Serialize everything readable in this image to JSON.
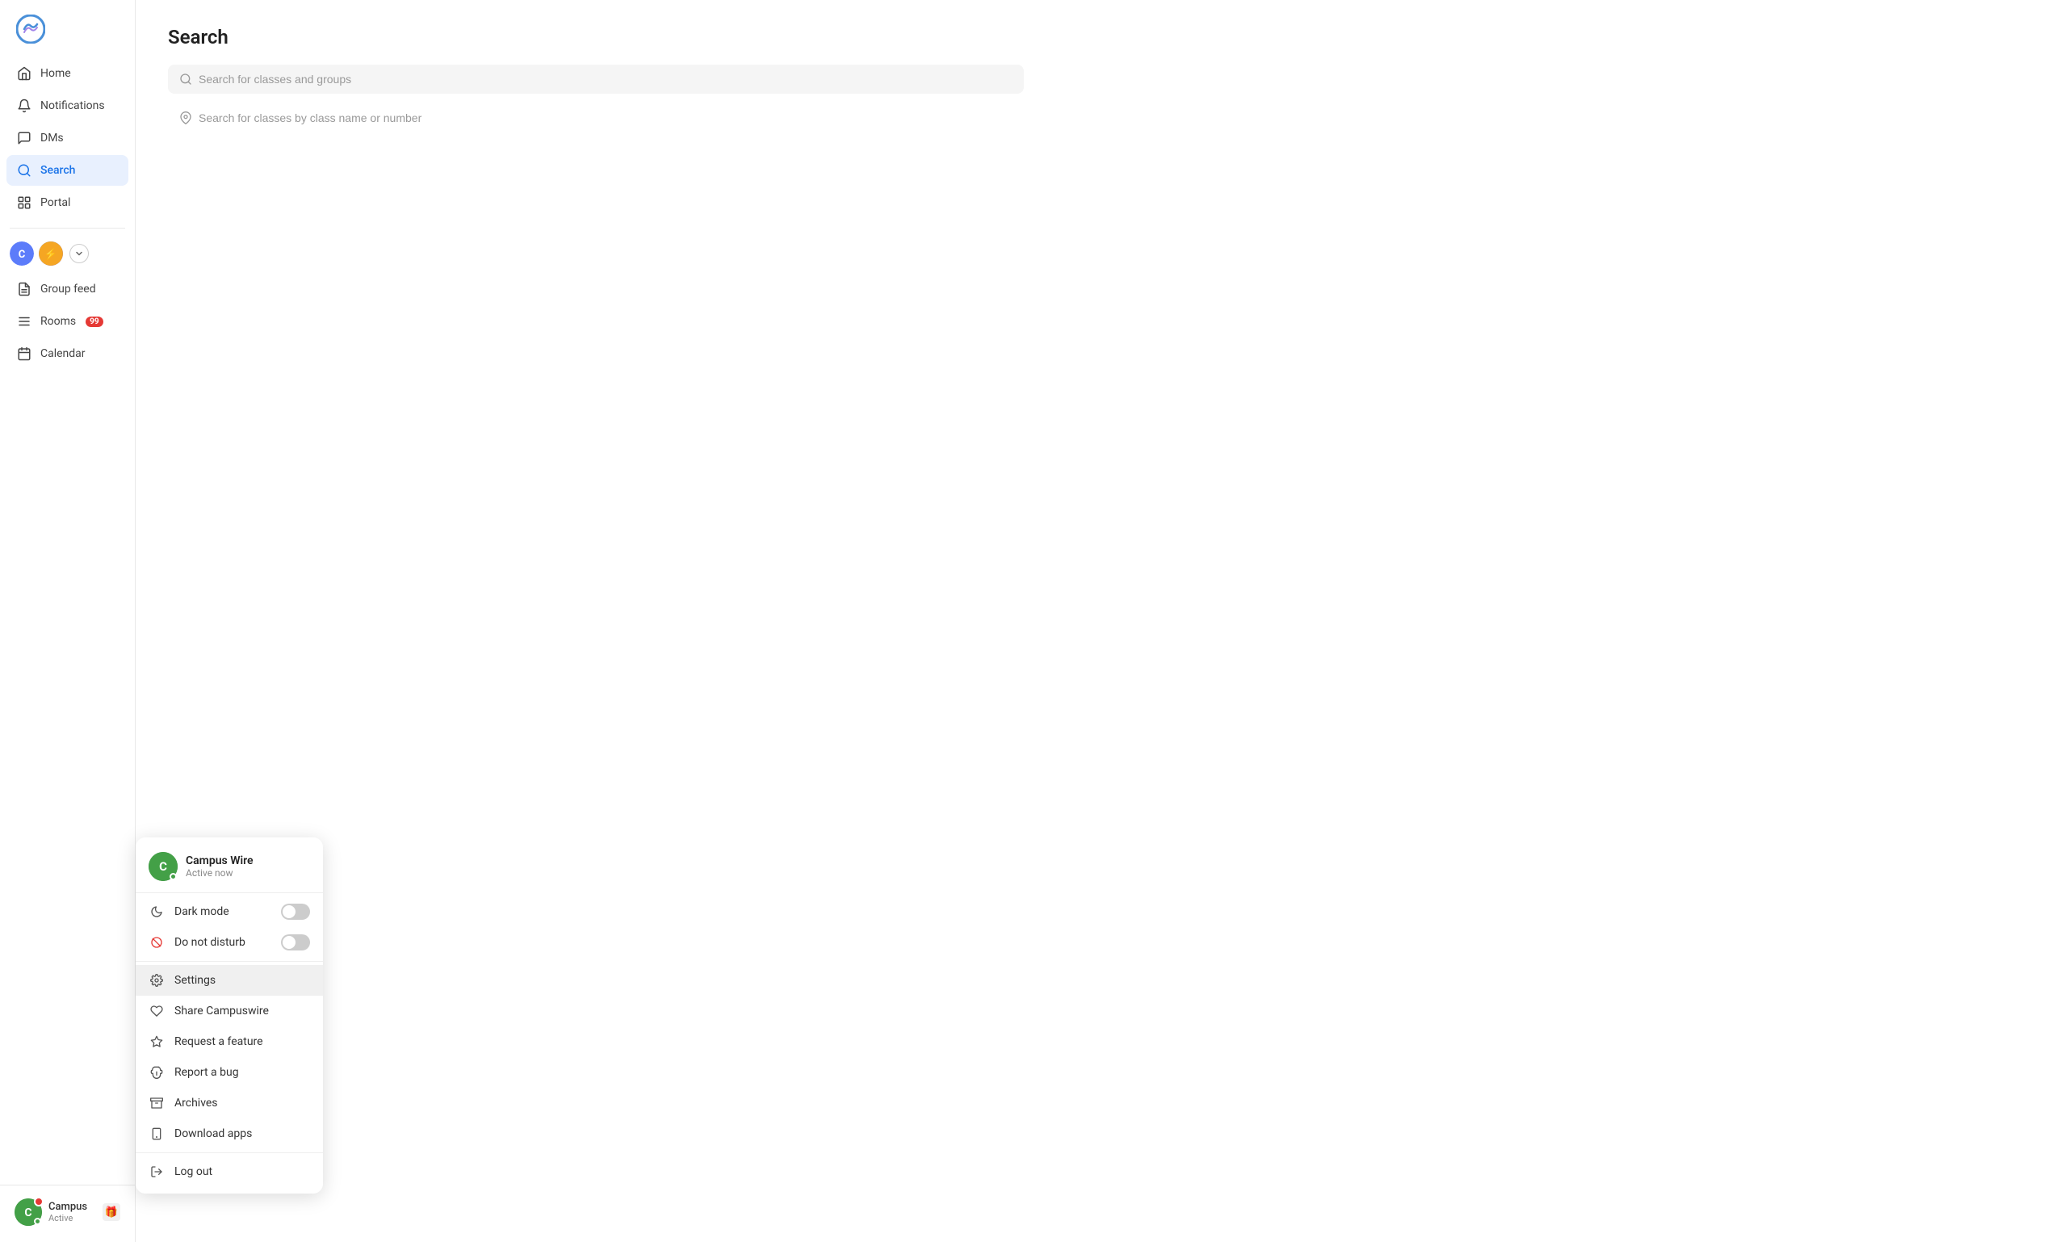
{
  "app": {
    "title": "Campus Wire"
  },
  "sidebar": {
    "nav_items": [
      {
        "id": "home",
        "label": "Home",
        "active": false
      },
      {
        "id": "notifications",
        "label": "Notifications",
        "active": false
      },
      {
        "id": "dms",
        "label": "DMs",
        "active": false
      },
      {
        "id": "search",
        "label": "Search",
        "active": true
      },
      {
        "id": "portal",
        "label": "Portal",
        "active": false
      }
    ],
    "group_section": [
      {
        "id": "group-feed",
        "label": "Group feed",
        "active": false
      },
      {
        "id": "rooms",
        "label": "Rooms",
        "badge": "99",
        "active": false
      },
      {
        "id": "calendar",
        "label": "Calendar",
        "active": false
      }
    ],
    "user": {
      "name": "Campus",
      "status": "Active"
    }
  },
  "search_page": {
    "title": "Search",
    "search_placeholder": "Search for classes and groups",
    "class_search_placeholder": "Search for classes by class name or number"
  },
  "dropdown": {
    "user_name": "Campus Wire",
    "user_status": "Active now",
    "items": [
      {
        "id": "dark-mode",
        "label": "Dark mode",
        "type": "toggle",
        "value": false
      },
      {
        "id": "do-not-disturb",
        "label": "Do not disturb",
        "type": "toggle",
        "value": false
      },
      {
        "id": "settings",
        "label": "Settings",
        "type": "action"
      },
      {
        "id": "share-campuswire",
        "label": "Share Campuswire",
        "type": "action"
      },
      {
        "id": "request-feature",
        "label": "Request a feature",
        "type": "action"
      },
      {
        "id": "report-bug",
        "label": "Report a bug",
        "type": "action"
      },
      {
        "id": "archives",
        "label": "Archives",
        "type": "action"
      },
      {
        "id": "download-apps",
        "label": "Download apps",
        "type": "action"
      },
      {
        "id": "log-out",
        "label": "Log out",
        "type": "action"
      }
    ]
  }
}
